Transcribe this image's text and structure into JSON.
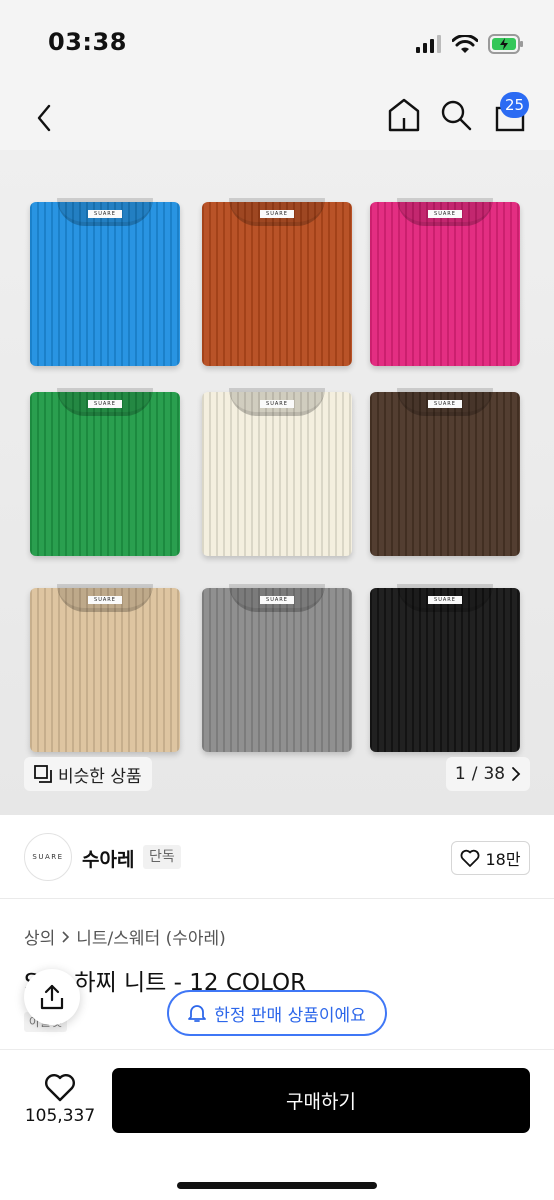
{
  "status": {
    "time": "03:38"
  },
  "nav": {
    "cart_count": "25"
  },
  "colors": {
    "accent": "#2b6bf3",
    "buy_button": "#000000"
  },
  "gallery": {
    "similar_label": "비슷한 상품",
    "page_current": "1",
    "page_sep": "/",
    "page_total": "38",
    "tag_text": "SUARE",
    "sweater_colors": [
      "#1e8ee0",
      "#b54a1c",
      "#e2237b",
      "#1f9a46",
      "#f3eedd",
      "#4a3426",
      "#dcc29c",
      "#8a8a8a",
      "#151515"
    ]
  },
  "brand": {
    "logo_text": "SUARE",
    "name": "수아레",
    "badge": "단독",
    "likes": "18만"
  },
  "product": {
    "breadcrumb": [
      "상의",
      "니트/스웨터 (수아레)"
    ],
    "title": "S  블 하찌 니트 - 12 COLOR",
    "tag": "아울렛"
  },
  "floating": {
    "limited_label": "한정 판매 상품이에요"
  },
  "bottom": {
    "like_count": "105,337",
    "buy_label": "구매하기"
  }
}
